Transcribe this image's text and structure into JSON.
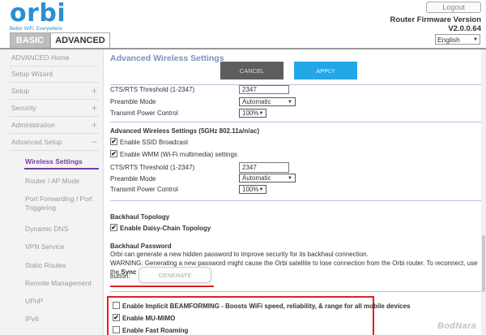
{
  "header": {
    "logo_text": "orbi",
    "logo_tagline": "Better WiFi. Everywhere",
    "logout_label": "Logout",
    "firmware_label": "Router Firmware Version",
    "firmware_version": "V2.0.0.64",
    "language": "English"
  },
  "tabs": [
    {
      "label": "BASIC"
    },
    {
      "label": "ADVANCED"
    }
  ],
  "sidebar": {
    "items": [
      {
        "label": "ADVANCED Home"
      },
      {
        "label": "Setup Wizard"
      },
      {
        "label": "Setup",
        "expander": "+"
      },
      {
        "label": "Security",
        "expander": "+"
      },
      {
        "label": "Administration",
        "expander": "+"
      },
      {
        "label": "Advanced Setup",
        "expander": "−"
      }
    ],
    "subitems": [
      {
        "label": "Wireless Settings"
      },
      {
        "label": "Router / AP Mode"
      },
      {
        "label": "Port Forwarding / Port"
      },
      {
        "label": "Triggering"
      },
      {
        "label": "Dynamic DNS"
      },
      {
        "label": "VPN Service"
      },
      {
        "label": "Static Routes"
      },
      {
        "label": "Remote Management"
      },
      {
        "label": "UPnP"
      },
      {
        "label": "IPv6"
      }
    ]
  },
  "main": {
    "title": "Advanced Wireless Settings",
    "cancel_label": "CANCEL",
    "apply_label": "APPLY",
    "band1": {
      "rts_label": "CTS/RTS Threshold (1-2347)",
      "rts_value": "2347",
      "preamble_label": "Preamble Mode",
      "preamble_value": "Automatic",
      "power_label": "Transmit Power Control",
      "power_value": "100%"
    },
    "band2": {
      "heading": "Advanced Wireless Settings (5GHz 802.11a/n/ac)",
      "ssid_label": "Enable SSID Broadcast",
      "wmm_label": "Enable WMM (Wi-Fi multimedia) settings",
      "rts_label": "CTS/RTS Threshold (1-2347)",
      "rts_value": "2347",
      "preamble_label": "Preamble Mode",
      "preamble_value": "Automatic",
      "power_label": "Transmit Power Control",
      "power_value": "100%"
    },
    "backhaul": {
      "topology_heading": "Backhaul Topology",
      "daisy_label": "Enable Daisy-Chain Topology",
      "password_heading": "Backhaul Password",
      "password_desc": "Orbi can generate a new hidden password to improve security for its backhaul connection.",
      "warning_text": "WARNING: Generating a new password might cause the Orbi satellite to lose connection from the Orbi router. To reconnect, use the",
      "warning_sync": "Sync",
      "warning_tail": "button.",
      "generate_label": "GENERATE"
    },
    "options": {
      "beamforming_label": "Enable Implicit BEAMFORMING - Boosts WiFi speed, reliability, & range for all mobile devices",
      "mumimo_label": "Enable MU-MIMO",
      "fastroam_label": "Enable Fast Roaming"
    }
  },
  "watermark": "BodNara",
  "colors": {
    "brand_blue": "#2b8fd3",
    "active_purple": "#7a3aa6",
    "apply_blue": "#23a7e6",
    "highlight_red": "#e31e24"
  }
}
